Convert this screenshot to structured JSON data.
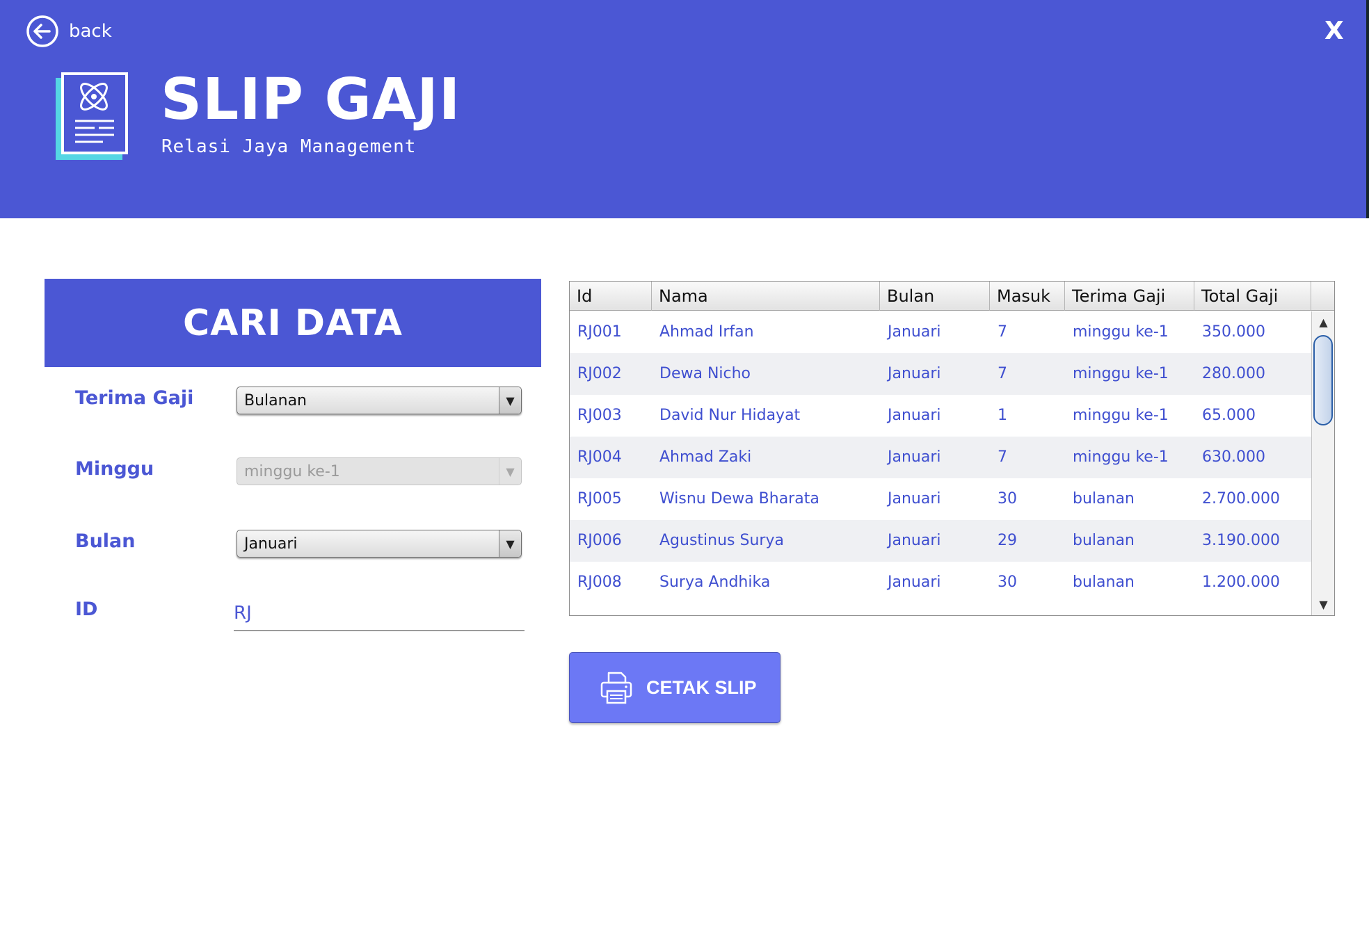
{
  "header": {
    "back_label": "back",
    "close_label": "X",
    "title": "SLIP GAJI",
    "subtitle": "Relasi Jaya Management",
    "brand_color": "#4b57d4"
  },
  "search": {
    "heading": "CARI DATA",
    "terima_gaji": {
      "label": "Terima Gaji",
      "value": "Bulanan"
    },
    "minggu": {
      "label": "Minggu",
      "value": "minggu ke-1"
    },
    "bulan": {
      "label": "Bulan",
      "value": "Januari"
    },
    "id": {
      "label": "ID",
      "value": "RJ"
    }
  },
  "table": {
    "columns": [
      "Id",
      "Nama",
      "Bulan",
      "Masuk",
      "Terima Gaji",
      "Total Gaji"
    ],
    "rows": [
      [
        "RJ001",
        "Ahmad Irfan",
        "Januari",
        "7",
        "minggu ke-1",
        "350.000"
      ],
      [
        "RJ002",
        "Dewa Nicho",
        "Januari",
        "7",
        "minggu ke-1",
        "280.000"
      ],
      [
        "RJ003",
        "David Nur Hidayat",
        "Januari",
        "1",
        "minggu ke-1",
        "65.000"
      ],
      [
        "RJ004",
        "Ahmad Zaki",
        "Januari",
        "7",
        "minggu ke-1",
        "630.000"
      ],
      [
        "RJ005",
        "Wisnu Dewa Bharata",
        "Januari",
        "30",
        "bulanan",
        "2.700.000"
      ],
      [
        "RJ006",
        "Agustinus Surya",
        "Januari",
        "29",
        "bulanan",
        "3.190.000"
      ],
      [
        "RJ008",
        "Surya Andhika",
        "Januari",
        "30",
        "bulanan",
        "1.200.000"
      ]
    ]
  },
  "actions": {
    "print_label": "CETAK SLIP",
    "print_icon": "printer-icon"
  }
}
